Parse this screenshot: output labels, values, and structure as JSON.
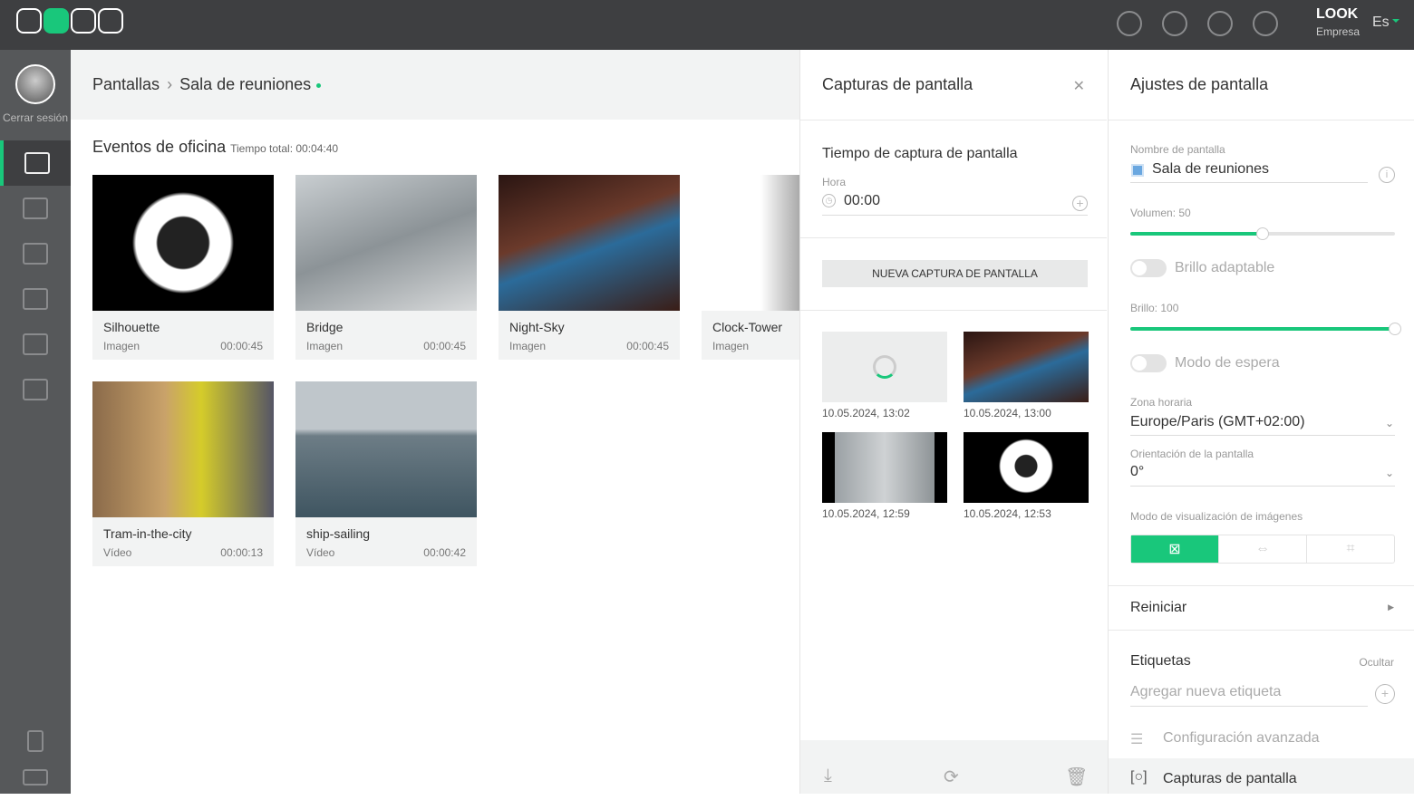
{
  "topbar": {
    "brand": "LOOK",
    "brand_sub": "Empresa",
    "language": "Es",
    "icons": [
      "pie-chart-icon",
      "users-icon",
      "bell-icon",
      "sliders-icon"
    ]
  },
  "sidebar": {
    "logout": "Cerrar sesión",
    "items": [
      "screens-icon",
      "gallery-icon",
      "playlist-icon",
      "calendar-icon",
      "star-icon",
      "layers-icon"
    ],
    "bottom": [
      "book-icon",
      "chat-icon"
    ]
  },
  "breadcrumb": {
    "root": "Pantallas",
    "current": "Sala de reuniones"
  },
  "playlist": {
    "title": "Eventos de oficina",
    "total": "Tiempo total: 00:04:40",
    "items": [
      {
        "name": "Silhouette",
        "type": "Imagen",
        "duration": "00:00:45"
      },
      {
        "name": "Bridge",
        "type": "Imagen",
        "duration": "00:00:45"
      },
      {
        "name": "Night-Sky",
        "type": "Imagen",
        "duration": "00:00:45"
      },
      {
        "name": "Clock-Tower",
        "type": "Imagen",
        "duration": ""
      },
      {
        "name": "Tram-in-the-city",
        "type": "Vídeo",
        "duration": "00:00:13"
      },
      {
        "name": "ship-sailing",
        "type": "Vídeo",
        "duration": "00:00:42"
      }
    ]
  },
  "captures": {
    "title": "Capturas de pantalla",
    "time_title": "Tiempo de captura de pantalla",
    "hour_label": "Hora",
    "hour_value": "00:00",
    "new_button": "NUEVA CAPTURA DE PANTALLA",
    "shots": [
      {
        "date": "10.05.2024, 13:02"
      },
      {
        "date": "10.05.2024, 13:00"
      },
      {
        "date": "10.05.2024, 12:59"
      },
      {
        "date": "10.05.2024, 12:53"
      }
    ]
  },
  "settings": {
    "title": "Ajustes de pantalla",
    "name_label": "Nombre de pantalla",
    "name_value": "Sala de reuniones",
    "volume_label": "Volumen: 50",
    "volume": 50,
    "adaptive_label": "Brillo adaptable",
    "adaptive_on": false,
    "brightness_label": "Brillo: 100",
    "brightness": 100,
    "standby_label": "Modo de espera",
    "standby_on": false,
    "tz_label": "Zona horaria",
    "tz_value": "Europe/Paris (GMT+02:00)",
    "orient_label": "Orientación de la pantalla",
    "orient_value": "0°",
    "display_mode_label": "Modo de visualización de imágenes",
    "restart": "Reiniciar",
    "tags_title": "Etiquetas",
    "tags_hide": "Ocultar",
    "tags_placeholder": "Agregar nueva etiqueta",
    "advanced": "Configuración avanzada",
    "screenshots": "Capturas de pantalla",
    "accent": "#19c77b"
  }
}
